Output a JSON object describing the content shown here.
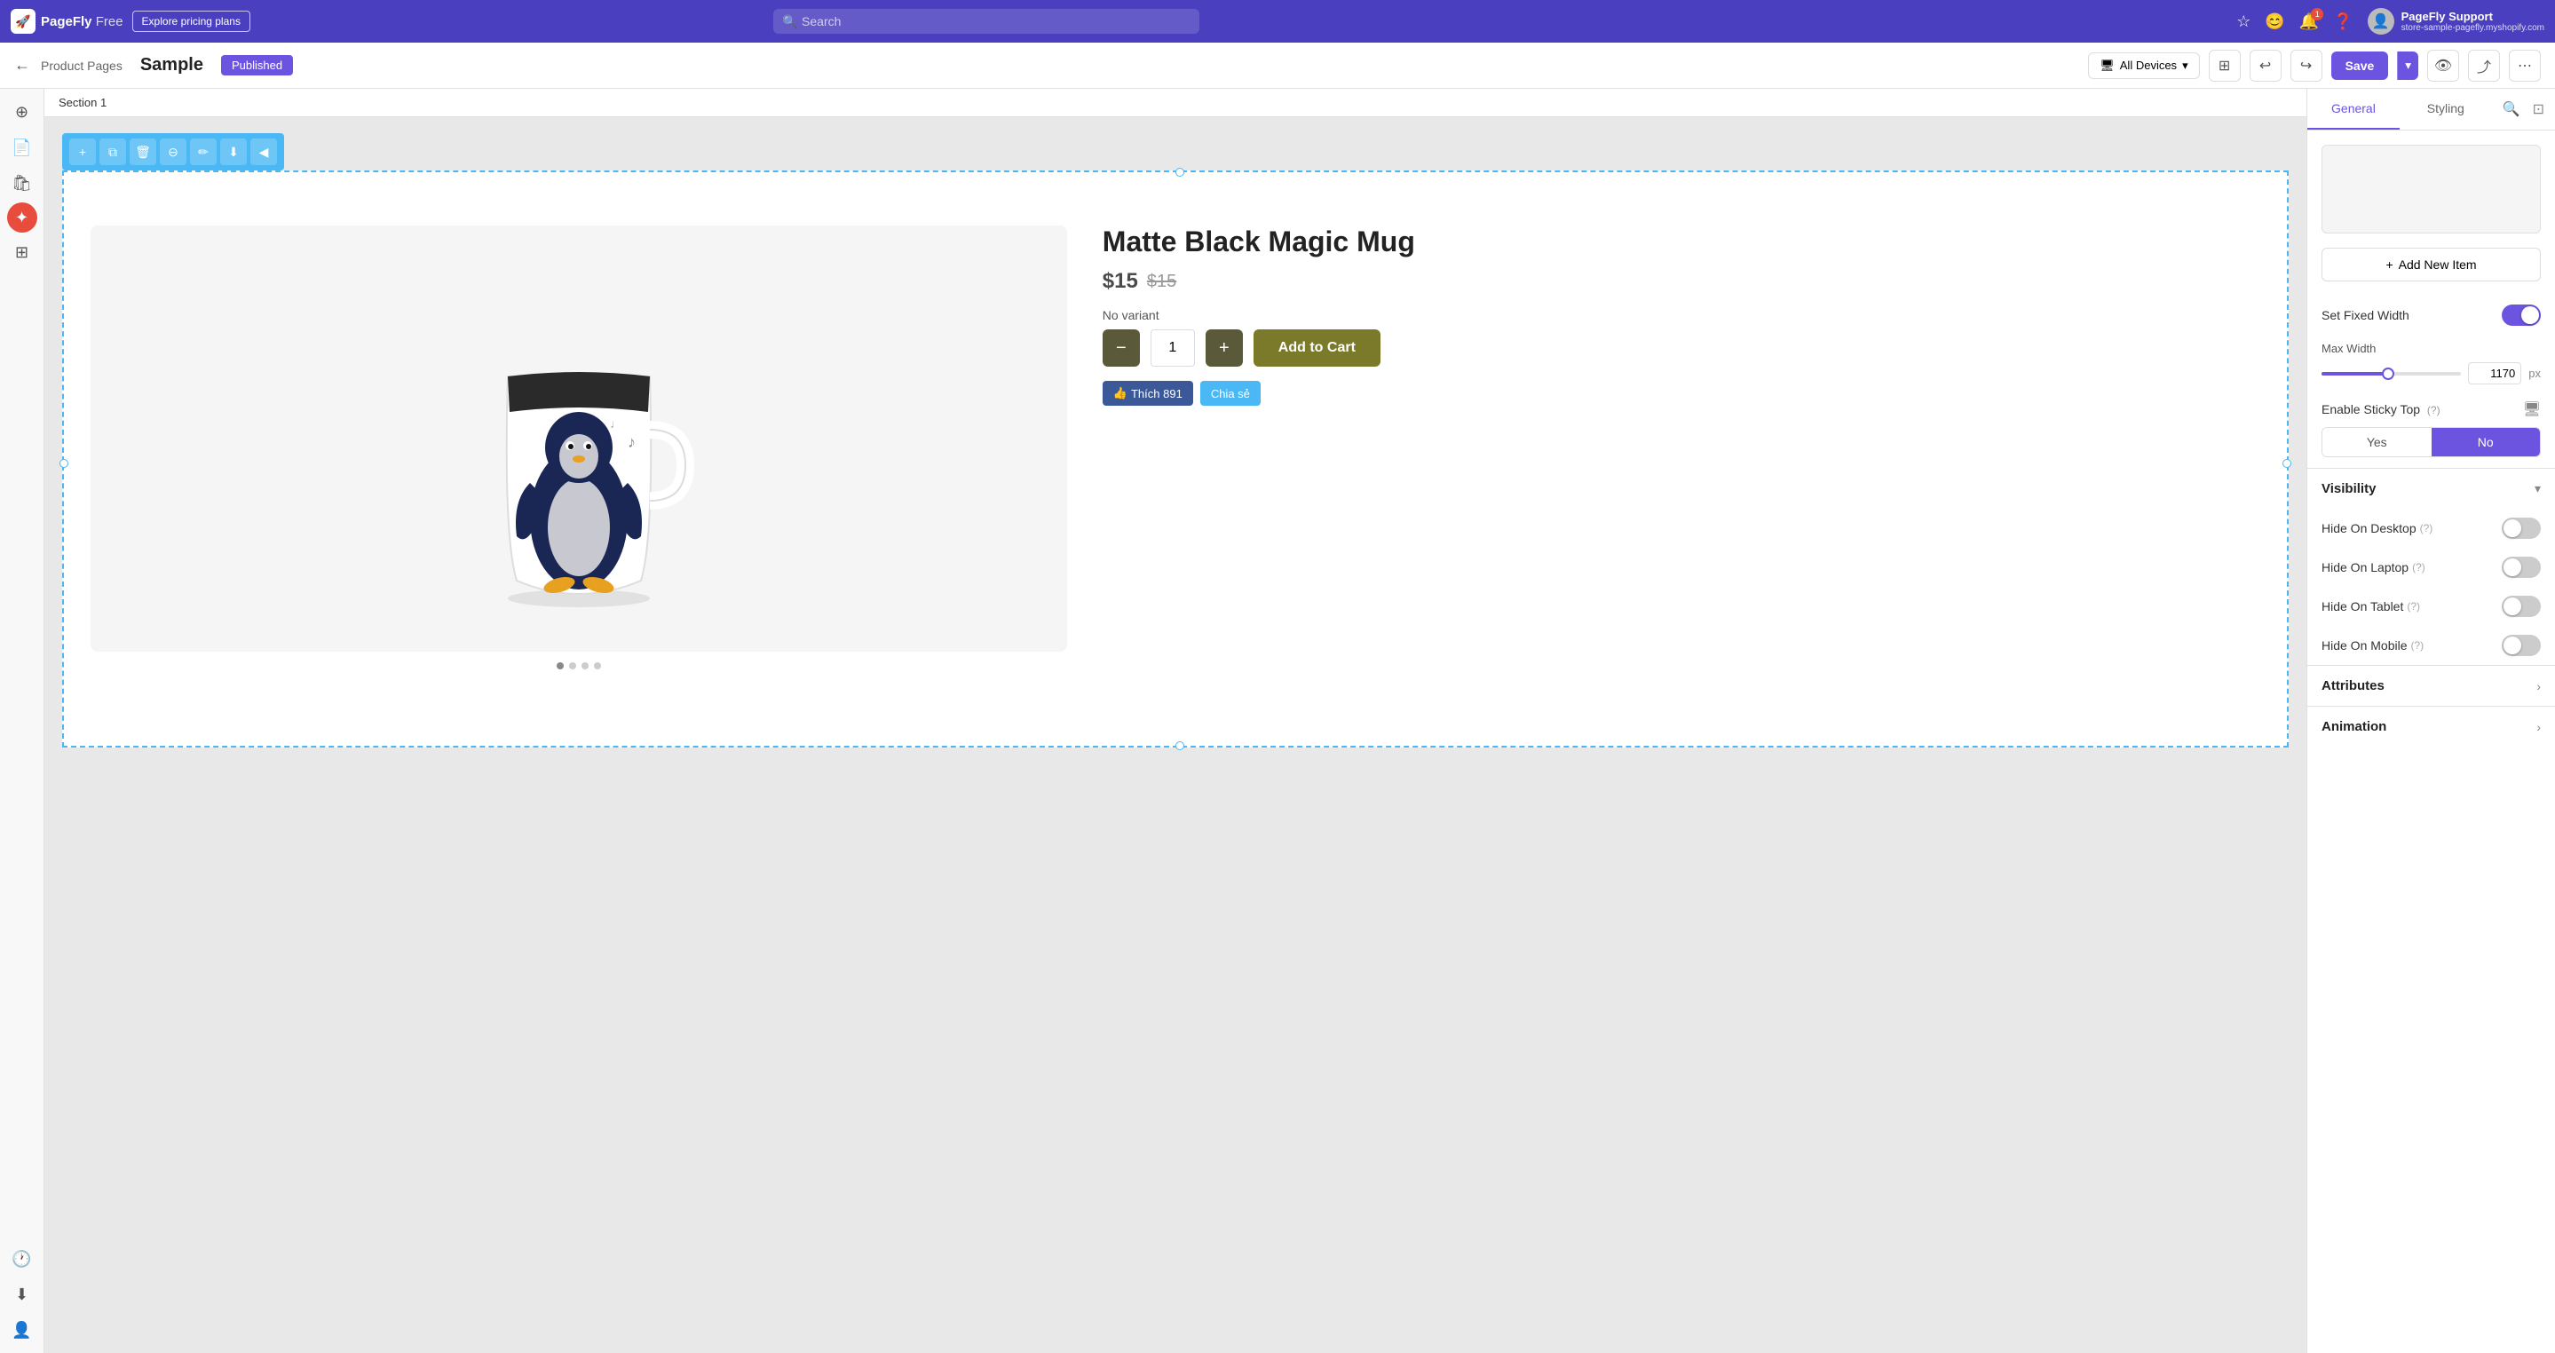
{
  "topnav": {
    "logo_text": "PageFly",
    "plan_text": "Free",
    "explore_btn": "Explore pricing plans",
    "search_placeholder": "Search",
    "notification_count": "1",
    "user_name": "PageFly Support",
    "user_store": "store-sample-pagefly.myshopify.com"
  },
  "secondbar": {
    "breadcrumb": "Product Pages",
    "page_title": "Sample",
    "published_label": "Published",
    "device_btn": "All Devices",
    "save_btn": "Save"
  },
  "canvas": {
    "section_title": "Section 1",
    "product_name": "Matte Black Magic Mug",
    "price_current": "$15",
    "price_original": "$15",
    "variant_label": "No variant",
    "quantity": "1",
    "add_to_cart": "Add to Cart",
    "fb_like": "Thích 891",
    "share": "Chia sẻ",
    "img_dots": [
      "dot1",
      "dot2",
      "dot3",
      "dot4"
    ]
  },
  "toolbar_buttons": [
    "+",
    "⧉",
    "🗑",
    "⊖",
    "✏",
    "⬇",
    "◀"
  ],
  "right_panel": {
    "tab_general": "General",
    "tab_styling": "Styling",
    "add_new_item": "Add New Item",
    "set_fixed_width": "Set Fixed Width",
    "max_width_label": "Max Width",
    "max_width_value": "1170",
    "max_width_unit": "px",
    "enable_sticky_top": "Enable Sticky Top",
    "sticky_yes": "Yes",
    "sticky_no": "No",
    "visibility_title": "Visibility",
    "hide_desktop": "Hide On Desktop",
    "hide_laptop": "Hide On Laptop",
    "hide_tablet": "Hide On Tablet",
    "hide_mobile": "Hide On Mobile",
    "attributes_title": "Attributes",
    "animation_title": "Animation"
  }
}
